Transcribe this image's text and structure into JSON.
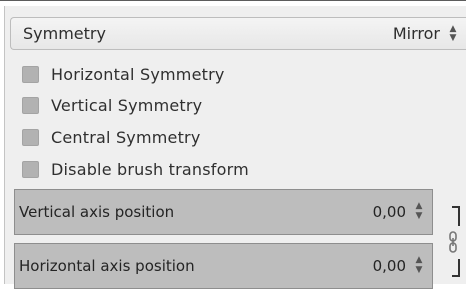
{
  "header": {
    "title": "Symmetry",
    "mode": "Mirror",
    "mode_spin_icon": "up-down-arrows-icon"
  },
  "options": [
    {
      "label": "Horizontal Symmetry",
      "checked": false
    },
    {
      "label": "Vertical Symmetry",
      "checked": false
    },
    {
      "label": "Central Symmetry",
      "checked": false
    },
    {
      "label": "Disable brush transform",
      "checked": false
    }
  ],
  "fields": [
    {
      "label": "Vertical axis position",
      "value": "0,00"
    },
    {
      "label": "Horizontal axis position",
      "value": "0,00"
    }
  ],
  "chain": {
    "icon": "chain-link-icon",
    "linked": true
  }
}
